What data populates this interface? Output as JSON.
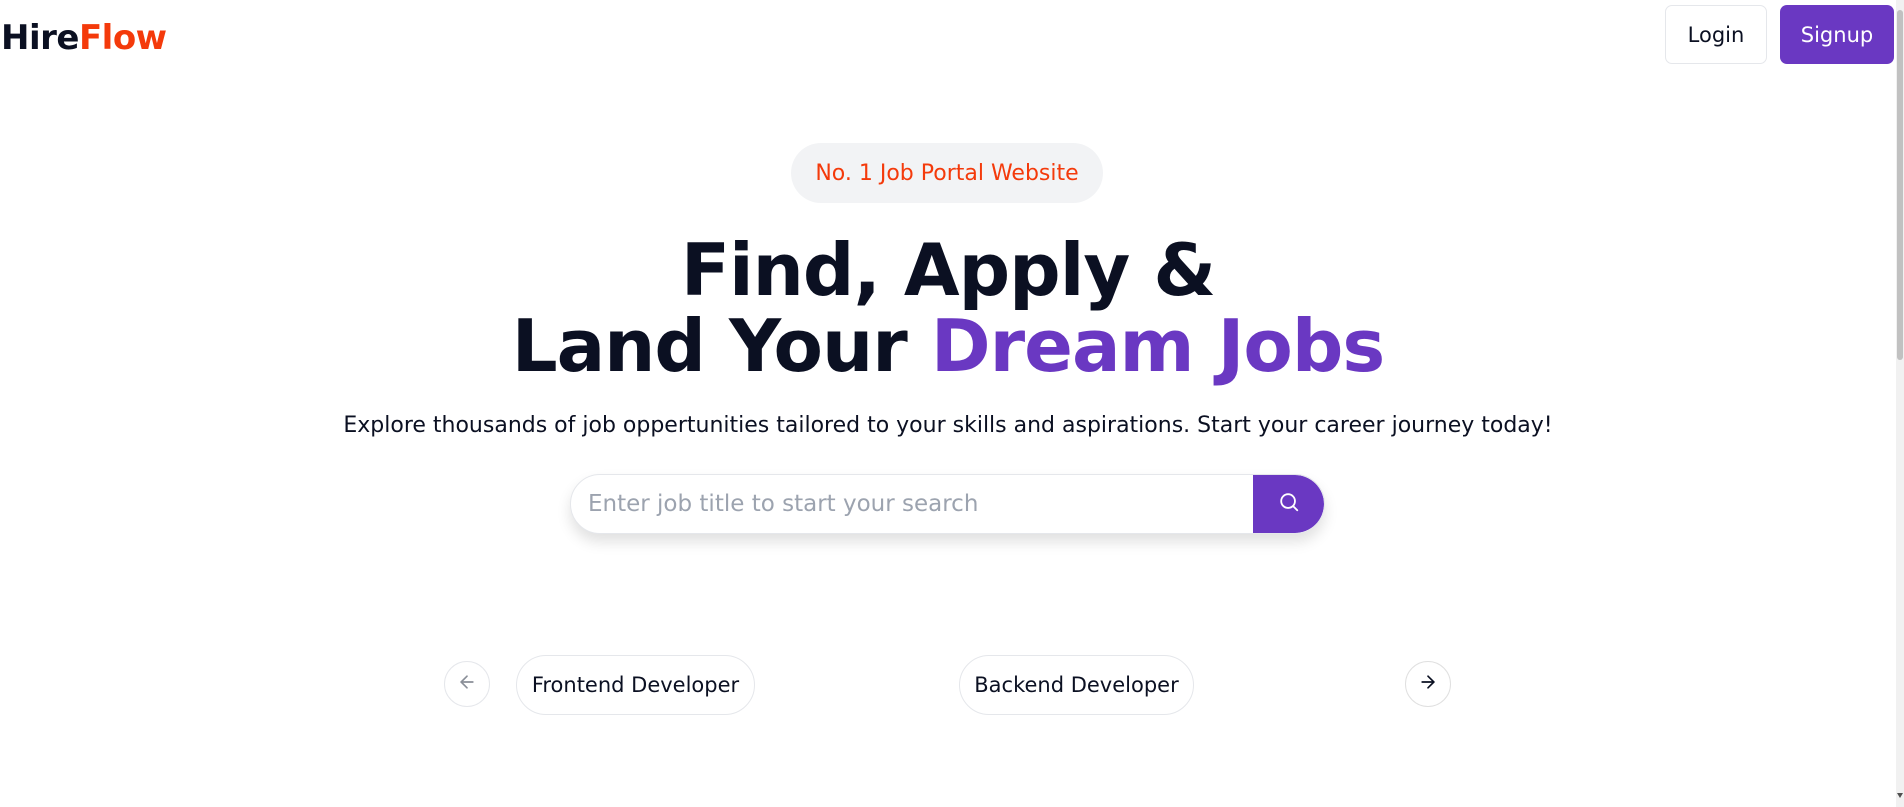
{
  "header": {
    "logo_part1": "Hire",
    "logo_part2": "Flow",
    "login_label": "Login",
    "signup_label": "Signup"
  },
  "hero": {
    "badge": "No. 1 Job Portal Website",
    "headline_line1": "Find, Apply &",
    "headline_line2_prefix": "Land Your ",
    "headline_line2_accent": "Dream Jobs",
    "subtitle": "Explore thousands of job oppertunities tailored to your skills and aspirations. Start your career journey today!"
  },
  "search": {
    "placeholder": "Enter job title to start your search",
    "value": ""
  },
  "carousel": {
    "categories": [
      "Frontend Developer",
      "Backend Developer"
    ]
  },
  "colors": {
    "accent": "#6a38c2",
    "brand_orange": "#f43a0b",
    "text_dark": "#0b1022"
  },
  "icons": {
    "search": "search-icon",
    "prev": "arrow-left-icon",
    "next": "arrow-right-icon"
  }
}
